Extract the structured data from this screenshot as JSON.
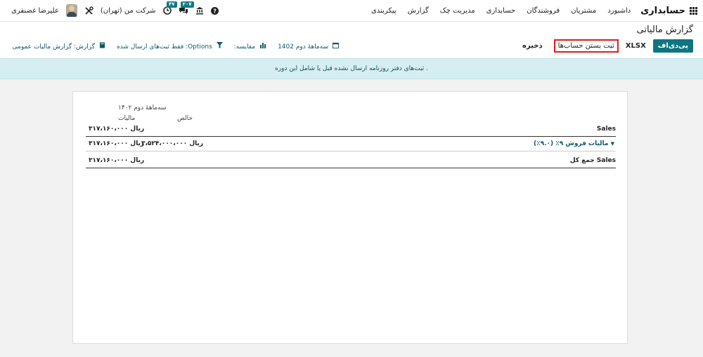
{
  "nav": {
    "app_title": "حسابداری",
    "menu": [
      "داشبورد",
      "مشتریان",
      "فروشندگان",
      "حسابداری",
      "مدیریت چک",
      "گزارش",
      "پیکربندی"
    ],
    "user_name": "علیرضا غضنفری",
    "company": "شرکت من (تهران)",
    "activity_badge": "۴۷",
    "messages_badge": "۲۰۷"
  },
  "control": {
    "page_title": "گزارش مالیاتی",
    "pdf_label": "پی‌دی‌اف",
    "xlsx_label": "XLSX",
    "close_books_label": "ثبت بستن حساب‌ها",
    "save_label": "ذخیره",
    "period_filter": "سه‌ماهۀ دوم 1402",
    "compare_filter": "مقایسه:",
    "options_filter": "Options: فقط ثبت‌های ارسال شده",
    "report_filter": "گزارش: گزارش مالیات عمومی"
  },
  "alert": {
    "text": ". ثبت‌های دفتر روزنامه ارسال نشده قبل یا شامل این دوره"
  },
  "report": {
    "period_header": "سه‌ماهۀ دوم ۱۴۰۲",
    "col_net": "خالص",
    "col_tax": "مالیات",
    "rows": [
      {
        "label": "Sales",
        "net": "",
        "tax": "۳۱۷،۱۶۰،۰۰۰ ریال"
      },
      {
        "label": "مالیات فروش ۹٪ (۹.۰٪)",
        "net": "۳،۵۲۴،۰۰۰،۰۰۰ ریال",
        "tax": "۳۱۷،۱۶۰،۰۰۰ ریال"
      },
      {
        "label": "جمع کل Sales",
        "net": "",
        "tax": "۳۱۷،۱۶۰،۰۰۰ ریال"
      }
    ]
  }
}
